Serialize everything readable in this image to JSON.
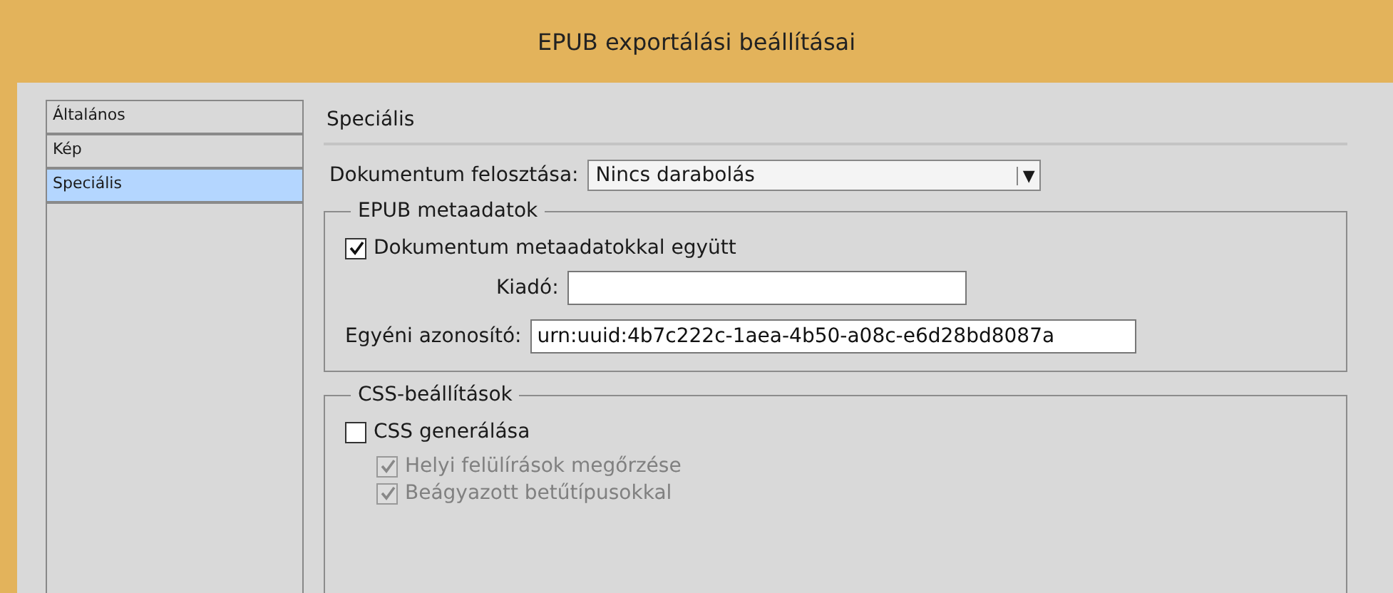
{
  "window": {
    "title": "EPUB exportálási beállításai"
  },
  "sidebar": {
    "items": [
      {
        "label": "Általános",
        "selected": false
      },
      {
        "label": "Kép",
        "selected": false
      },
      {
        "label": "Speciális",
        "selected": true
      }
    ]
  },
  "panel": {
    "heading": "Speciális",
    "split": {
      "label": "Dokumentum felosztása:",
      "value": "Nincs darabolás",
      "arrow": "▼"
    },
    "epub_metadata": {
      "legend": "EPUB metaadatok",
      "include": {
        "label": "Dokumentum metaadatokkal együtt",
        "checked": true,
        "disabled": false
      },
      "publisher": {
        "label": "Kiadó:"
      },
      "identifier": {
        "label": "Egyéni azonosító:",
        "value": "urn:uuid:4b7c222c-1aea-4b50-a08c-e6d28bd8087a"
      }
    },
    "css": {
      "legend": "CSS-beállítások",
      "options": [
        {
          "label": "CSS generálása",
          "checked": false,
          "disabled": false,
          "children": [
            {
              "label": "Helyi felülírások megőrzése",
              "checked": true,
              "disabled": true
            },
            {
              "label": "Beágyazott betűtípusokkal",
              "checked": true,
              "disabled": true
            }
          ]
        }
      ]
    }
  }
}
